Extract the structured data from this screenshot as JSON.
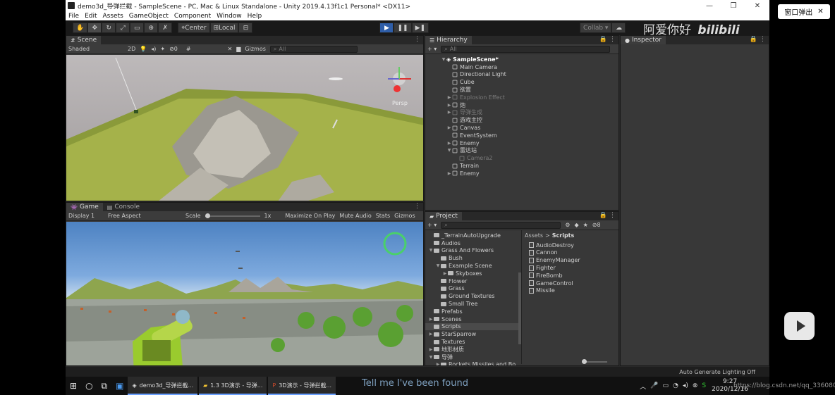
{
  "window": {
    "title": "demo3d_导弹拦截 - SampleScene - PC, Mac & Linux Standalone - Unity 2019.4.13f1c1 Personal* <DX11>"
  },
  "menu": [
    "File",
    "Edit",
    "Assets",
    "GameObject",
    "Component",
    "Window",
    "Help"
  ],
  "toolbar": {
    "pivot": "Center",
    "space": "Local",
    "collab": "Collab"
  },
  "scene": {
    "tab": "Scene",
    "shading": "Shaded",
    "mode": "2D",
    "gizmos": "Gizmos",
    "search_placeholder": "All",
    "persp_label": "Persp",
    "fx_count": "0"
  },
  "game": {
    "tab_game": "Game",
    "tab_console": "Console",
    "display": "Display 1",
    "aspect": "Free Aspect",
    "scale_label": "Scale",
    "scale_value": "1x",
    "maximize": "Maximize On Play",
    "mute": "Mute Audio",
    "stats": "Stats",
    "gizmos": "Gizmos"
  },
  "hierarchy": {
    "tab": "Hierarchy",
    "search_placeholder": "All",
    "scene_name": "SampleScene*",
    "items": [
      {
        "label": "Main Camera",
        "dim": false,
        "arrow": ""
      },
      {
        "label": "Directional Light",
        "dim": false,
        "arrow": ""
      },
      {
        "label": "Cube",
        "dim": false,
        "arrow": ""
      },
      {
        "label": "欲置",
        "dim": false,
        "arrow": ""
      },
      {
        "label": "Explosion Effect",
        "dim": true,
        "arrow": "▶"
      },
      {
        "label": "炮",
        "dim": false,
        "arrow": "▶"
      },
      {
        "label": "导弹生成",
        "dim": true,
        "arrow": "▶"
      },
      {
        "label": "游戏主控",
        "dim": false,
        "arrow": ""
      },
      {
        "label": "Canvas",
        "dim": false,
        "arrow": "▶"
      },
      {
        "label": "EventSystem",
        "dim": false,
        "arrow": ""
      },
      {
        "label": "Enemy",
        "dim": false,
        "arrow": "▶"
      },
      {
        "label": "雷达站",
        "dim": false,
        "arrow": "▼"
      },
      {
        "label": "Camera2",
        "dim": true,
        "arrow": "",
        "indent": true
      },
      {
        "label": "Terrain",
        "dim": false,
        "arrow": ""
      },
      {
        "label": "Enemy",
        "dim": false,
        "arrow": "▶"
      }
    ]
  },
  "inspector": {
    "tab": "Inspector"
  },
  "project": {
    "tab": "Project",
    "search_placeholder": "",
    "count": "8",
    "breadcrumb_root": "Assets",
    "breadcrumb_sep": ">",
    "breadcrumb_current": "Scripts",
    "folders": [
      {
        "label": "_TerrainAutoUpgrade",
        "depth": 0,
        "arrow": ""
      },
      {
        "label": "Audios",
        "depth": 0,
        "arrow": ""
      },
      {
        "label": "Grass And Flowers",
        "depth": 0,
        "arrow": "▼"
      },
      {
        "label": "Bush",
        "depth": 1,
        "arrow": ""
      },
      {
        "label": "Example Scene",
        "depth": 1,
        "arrow": "▼"
      },
      {
        "label": "Skyboxes",
        "depth": 2,
        "arrow": "▶"
      },
      {
        "label": "Flower",
        "depth": 1,
        "arrow": ""
      },
      {
        "label": "Grass",
        "depth": 1,
        "arrow": ""
      },
      {
        "label": "Ground Textures",
        "depth": 1,
        "arrow": ""
      },
      {
        "label": "Small Tree",
        "depth": 1,
        "arrow": ""
      },
      {
        "label": "Prefabs",
        "depth": 0,
        "arrow": ""
      },
      {
        "label": "Scenes",
        "depth": 0,
        "arrow": "▶"
      },
      {
        "label": "Scripts",
        "depth": 0,
        "arrow": "",
        "selected": true
      },
      {
        "label": "StarSparrow",
        "depth": 0,
        "arrow": "▶"
      },
      {
        "label": "Textures",
        "depth": 0,
        "arrow": ""
      },
      {
        "label": "地形材质",
        "depth": 0,
        "arrow": "▶"
      },
      {
        "label": "导弹",
        "depth": 0,
        "arrow": "▼"
      },
      {
        "label": "Rockets Missiles and Bo",
        "depth": 1,
        "arrow": "▶"
      }
    ],
    "files": [
      "AudioDestroy",
      "Cannon",
      "EnemyManager",
      "Fighter",
      "FireBomb",
      "GameControl",
      "Missile"
    ]
  },
  "status": {
    "lighting": "Auto Generate Lighting Off"
  },
  "taskbar": {
    "items": [
      "demo3d_导弹拦截...",
      "1.3 3D演示 - 导弹...",
      "3D演示 - 导弹拦截..."
    ],
    "time": "9:27",
    "date": "2020/12/16"
  },
  "overlay": {
    "popout": "窗口弹出",
    "popout_close": "✕",
    "subtitle": "Tell me I've been found",
    "watermark": "阿爱你好",
    "bili": "bilibili",
    "url": "https://blog.csdn.net/qq_33608000"
  }
}
